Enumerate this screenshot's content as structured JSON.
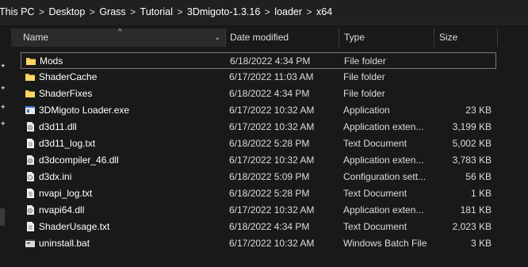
{
  "breadcrumb": [
    "This PC",
    "Desktop",
    "Grass",
    "Tutorial",
    "3Dmigoto-1.3.16",
    "loader",
    "x64"
  ],
  "breadcrumb_separator": ">",
  "columns": {
    "name": "Name",
    "date": "Date modified",
    "type": "Type",
    "size": "Size"
  },
  "files": [
    {
      "name": "Mods",
      "date": "6/18/2022 4:34 PM",
      "type": "File folder",
      "size": "",
      "icon": "folder-icon"
    },
    {
      "name": "ShaderCache",
      "date": "6/17/2022 11:03 AM",
      "type": "File folder",
      "size": "",
      "icon": "folder-icon"
    },
    {
      "name": "ShaderFixes",
      "date": "6/18/2022 4:34 PM",
      "type": "File folder",
      "size": "",
      "icon": "folder-icon"
    },
    {
      "name": "3DMigoto Loader.exe",
      "date": "6/17/2022 10:32 AM",
      "type": "Application",
      "size": "23 KB",
      "icon": "exe-icon"
    },
    {
      "name": "d3d11.dll",
      "date": "6/17/2022 10:32 AM",
      "type": "Application exten...",
      "size": "3,199 KB",
      "icon": "dll-icon"
    },
    {
      "name": "d3d11_log.txt",
      "date": "6/18/2022 5:28 PM",
      "type": "Text Document",
      "size": "5,002 KB",
      "icon": "text-file-icon"
    },
    {
      "name": "d3dcompiler_46.dll",
      "date": "6/17/2022 10:32 AM",
      "type": "Application exten...",
      "size": "3,783 KB",
      "icon": "dll-icon"
    },
    {
      "name": "d3dx.ini",
      "date": "6/18/2022 5:09 PM",
      "type": "Configuration sett...",
      "size": "56 KB",
      "icon": "ini-icon"
    },
    {
      "name": "nvapi_log.txt",
      "date": "6/18/2022 5:28 PM",
      "type": "Text Document",
      "size": "1 KB",
      "icon": "text-file-icon"
    },
    {
      "name": "nvapi64.dll",
      "date": "6/17/2022 10:32 AM",
      "type": "Application exten...",
      "size": "181 KB",
      "icon": "dll-icon"
    },
    {
      "name": "ShaderUsage.txt",
      "date": "6/18/2022 4:34 PM",
      "type": "Text Document",
      "size": "2,023 KB",
      "icon": "text-file-icon"
    },
    {
      "name": "uninstall.bat",
      "date": "6/17/2022 10:32 AM",
      "type": "Windows Batch File",
      "size": "3 KB",
      "icon": "bat-icon"
    }
  ],
  "selected_index": 0,
  "colors": {
    "background": "#191919",
    "folder": "#f5c24c",
    "selection_border": "#7a7a7a"
  }
}
